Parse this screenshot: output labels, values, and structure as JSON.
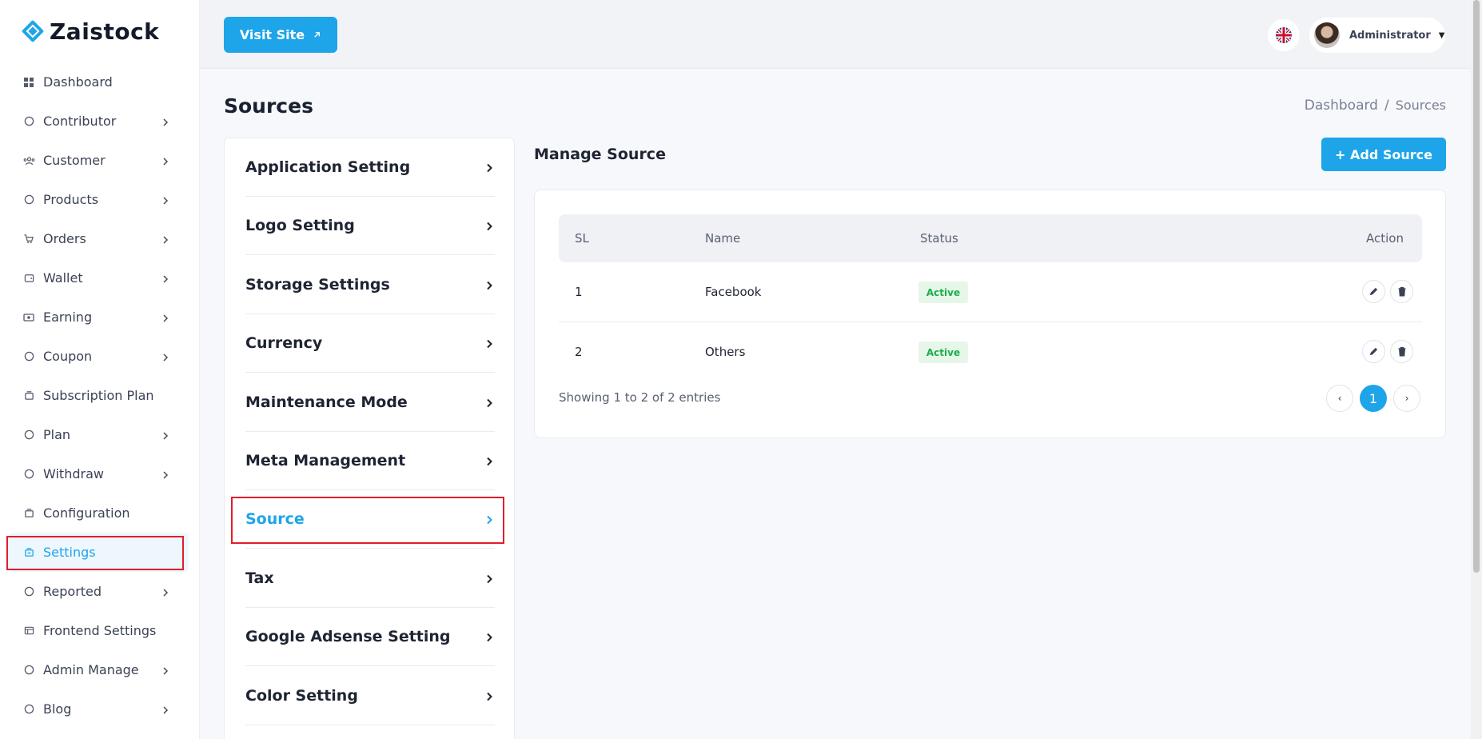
{
  "brand": {
    "name": "Zaistock",
    "accent": "#1ea5e9",
    "highlight": "#e11d2a"
  },
  "sidebar": {
    "items": [
      {
        "label": "Dashboard",
        "icon": "grid-icon",
        "chevron": false,
        "active": false
      },
      {
        "label": "Contributor",
        "icon": "user-pen-icon",
        "chevron": true,
        "active": false
      },
      {
        "label": "Customer",
        "icon": "users-icon",
        "chevron": true,
        "active": false
      },
      {
        "label": "Products",
        "icon": "circle-p-icon",
        "chevron": true,
        "active": false
      },
      {
        "label": "Orders",
        "icon": "cart-icon",
        "chevron": true,
        "active": false
      },
      {
        "label": "Wallet",
        "icon": "wallet-icon",
        "chevron": true,
        "active": false
      },
      {
        "label": "Earning",
        "icon": "money-icon",
        "chevron": true,
        "active": false
      },
      {
        "label": "Coupon",
        "icon": "coupon-icon",
        "chevron": true,
        "active": false
      },
      {
        "label": "Subscription Plan",
        "icon": "stack-icon",
        "chevron": false,
        "active": false
      },
      {
        "label": "Plan",
        "icon": "euro-icon",
        "chevron": true,
        "active": false
      },
      {
        "label": "Withdraw",
        "icon": "withdraw-icon",
        "chevron": true,
        "active": false
      },
      {
        "label": "Configuration",
        "icon": "stack-icon",
        "chevron": false,
        "active": false
      },
      {
        "label": "Settings",
        "icon": "settings-icon",
        "chevron": false,
        "active": true
      },
      {
        "label": "Reported",
        "icon": "info-icon",
        "chevron": true,
        "active": false
      },
      {
        "label": "Frontend Settings",
        "icon": "layout-icon",
        "chevron": false,
        "active": false
      },
      {
        "label": "Admin Manage",
        "icon": "admin-icon",
        "chevron": true,
        "active": false
      },
      {
        "label": "Blog",
        "icon": "blog-icon",
        "chevron": true,
        "active": false
      }
    ]
  },
  "header": {
    "visit_site": "Visit Site",
    "user_name": "Administrator",
    "language_icon": "uk-flag-icon"
  },
  "page": {
    "title": "Sources",
    "breadcrumb": [
      "Dashboard",
      "/",
      "Sources"
    ]
  },
  "settings_menu": [
    {
      "label": "Application Setting",
      "active": false
    },
    {
      "label": "Logo Setting",
      "active": false
    },
    {
      "label": "Storage Settings",
      "active": false
    },
    {
      "label": "Currency",
      "active": false
    },
    {
      "label": "Maintenance Mode",
      "active": false
    },
    {
      "label": "Meta Management",
      "active": false
    },
    {
      "label": "Source",
      "active": true
    },
    {
      "label": "Tax",
      "active": false
    },
    {
      "label": "Google Adsense Setting",
      "active": false
    },
    {
      "label": "Color Setting",
      "active": false
    }
  ],
  "manage": {
    "title": "Manage Source",
    "add_button": "+ Add Source",
    "columns": [
      "SL",
      "Name",
      "Status",
      "Action"
    ],
    "rows": [
      {
        "sl": "1",
        "name": "Facebook",
        "status": "Active"
      },
      {
        "sl": "2",
        "name": "Others",
        "status": "Active"
      }
    ],
    "showing": "Showing 1 to 2 of 2 entries",
    "pagination": {
      "prev": "‹",
      "current": "1",
      "next": "›"
    }
  }
}
